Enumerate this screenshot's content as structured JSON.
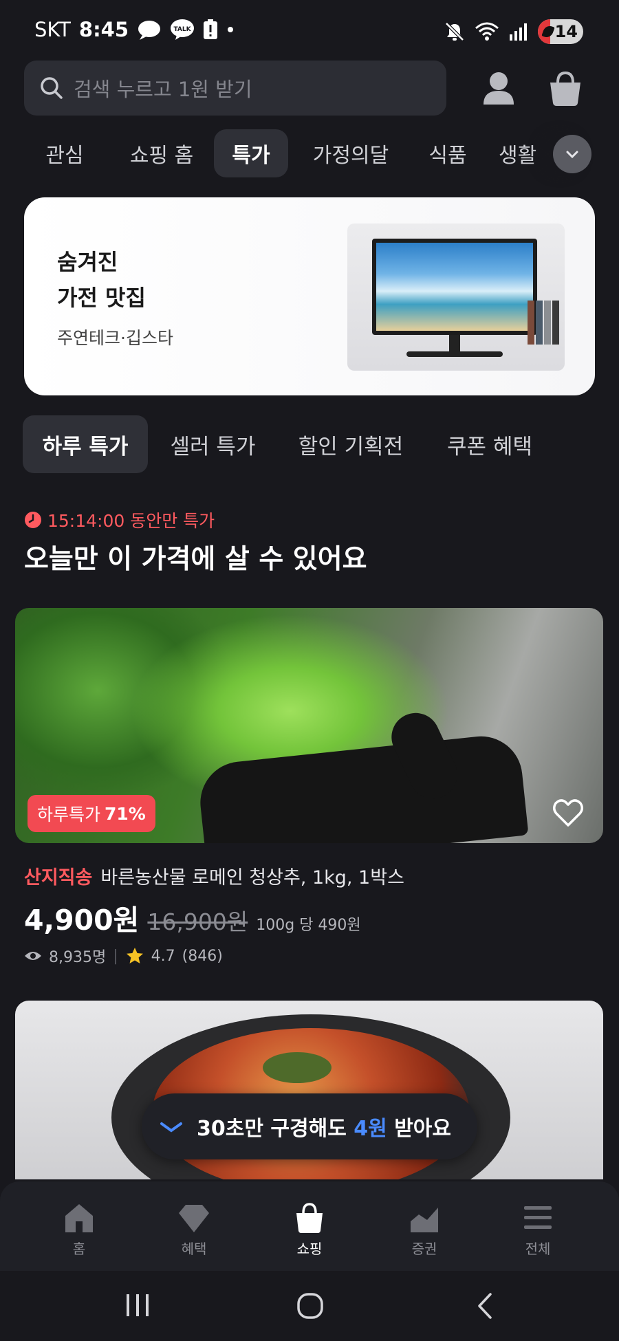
{
  "status_bar": {
    "carrier": "SKT",
    "time": "8:45",
    "battery": "14",
    "notification_icons": [
      "chat-bubble-icon",
      "kakaotalk-icon",
      "alert-icon"
    ]
  },
  "search": {
    "placeholder": "검색 누르고 1원 받기"
  },
  "category_tabs": [
    {
      "label": "관심",
      "active": false
    },
    {
      "label": "쇼핑 홈",
      "active": false
    },
    {
      "label": "특가",
      "active": true
    },
    {
      "label": "가정의달",
      "active": false
    },
    {
      "label": "식품",
      "active": false
    },
    {
      "label": "생활",
      "active": false
    }
  ],
  "banner": {
    "title_line1": "숨겨진",
    "title_line2": "가전 맛집",
    "subtitle": "주연테크·깁스타"
  },
  "sub_tabs": [
    {
      "label": "하루 특가",
      "active": true
    },
    {
      "label": "셀러 특가",
      "active": false
    },
    {
      "label": "할인 기획전",
      "active": false
    },
    {
      "label": "쿠폰 혜택",
      "active": false
    }
  ],
  "deal_section": {
    "timer_text": "15:14:00 동안만 특가",
    "title": "오늘만 이 가격에 살 수 있어요"
  },
  "product": {
    "badge_label": "하루특가",
    "badge_pct": "71%",
    "brand": "산지직송",
    "name": "바른농산물 로메인 청상추, 1kg, 1박스",
    "price": "4,900원",
    "original_price": "16,900원",
    "unit_price": "100g 당 490원",
    "views": "8,935명",
    "rating": "4.7",
    "review_count": "(846)"
  },
  "toast": {
    "prefix": "30초만 구경해도",
    "highlight": "4원",
    "suffix": "받아요"
  },
  "bottom_nav": [
    {
      "label": "홈",
      "icon": "home-icon",
      "active": false
    },
    {
      "label": "혜택",
      "icon": "diamond-icon",
      "active": false
    },
    {
      "label": "쇼핑",
      "icon": "shopping-bag-icon",
      "active": true
    },
    {
      "label": "증권",
      "icon": "chart-icon",
      "active": false
    },
    {
      "label": "전체",
      "icon": "menu-icon",
      "active": false
    }
  ],
  "colors": {
    "background": "#18181d",
    "accent_red": "#ff5a5f",
    "highlight_blue": "#4a8bff",
    "badge_red": "#f24a52"
  }
}
